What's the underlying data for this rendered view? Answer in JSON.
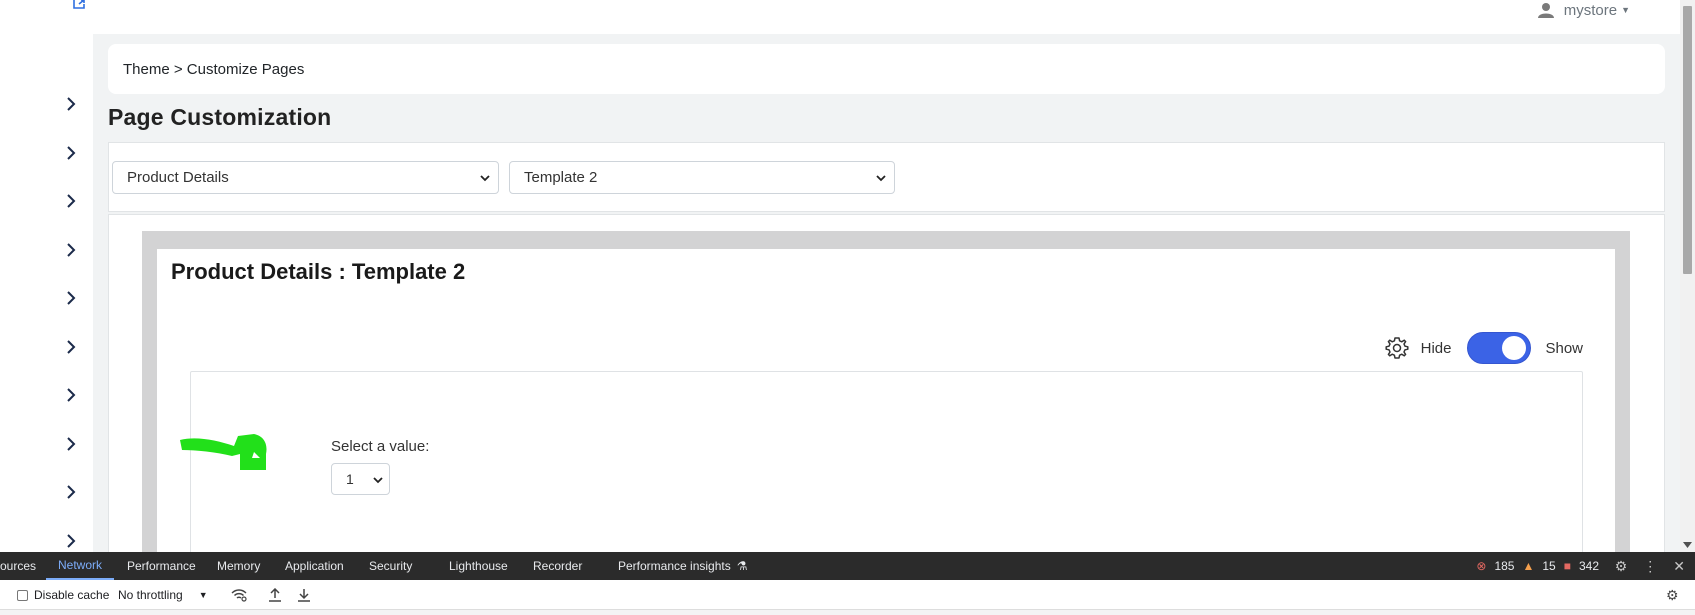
{
  "header": {
    "user_name": "mystore"
  },
  "breadcrumb": {
    "text": "Theme > Customize Pages"
  },
  "page": {
    "title": "Page Customization"
  },
  "selectors": {
    "page_select": "Product Details",
    "template_select": "Template 2"
  },
  "preview": {
    "title": "Product Details : Template 2",
    "hide_label": "Hide",
    "show_label": "Show",
    "toggle_on": true,
    "select_label": "Select a value:",
    "select_value": "1"
  },
  "devtools": {
    "tabs": [
      "ources",
      "Network",
      "Performance",
      "Memory",
      "Application",
      "Security",
      "Lighthouse",
      "Recorder",
      "Performance insights"
    ],
    "active_tab": "Network",
    "errors": "185",
    "warnings": "15",
    "issues": "342",
    "disable_cache_label": "Disable cache",
    "throttling_label": "No throttling"
  },
  "colors": {
    "accent": "#3b63e6",
    "scribble": "#22e01a",
    "main_bg": "#f1f3f4",
    "frame_bg": "#d3d3d4"
  }
}
